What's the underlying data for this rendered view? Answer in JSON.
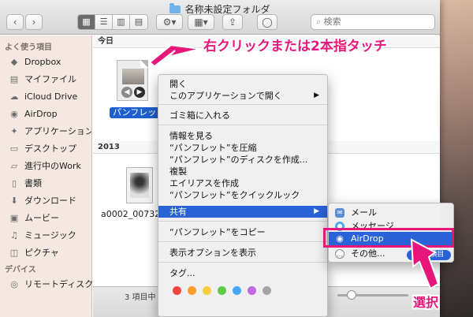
{
  "window": {
    "title": "名称未設定フォルダ",
    "search_placeholder": "検索"
  },
  "toolbar": {
    "back_icon": "chevron-left-icon",
    "forward_icon": "chevron-right-icon",
    "view_modes": [
      "icon-view",
      "list-view",
      "column-view",
      "coverflow-view"
    ],
    "active_view": "icon-view"
  },
  "sidebar": {
    "favorites_header": "よく使う項目",
    "items": [
      {
        "label": "Dropbox",
        "icon": "dropbox-icon"
      },
      {
        "label": "マイファイル",
        "icon": "all-files-icon"
      },
      {
        "label": "iCloud Drive",
        "icon": "cloud-icon"
      },
      {
        "label": "AirDrop",
        "icon": "airdrop-icon"
      },
      {
        "label": "アプリケーション",
        "icon": "applications-icon"
      },
      {
        "label": "デスクトップ",
        "icon": "desktop-icon"
      },
      {
        "label": "進行中のWork",
        "icon": "folder-icon"
      },
      {
        "label": "書類",
        "icon": "documents-icon"
      },
      {
        "label": "ダウンロード",
        "icon": "download-icon"
      },
      {
        "label": "ムービー",
        "icon": "movies-icon"
      },
      {
        "label": "ミュージック",
        "icon": "music-icon"
      },
      {
        "label": "ピクチャ",
        "icon": "pictures-icon"
      }
    ],
    "devices_header": "デバイス",
    "device_items": [
      {
        "label": "リモートディスク",
        "icon": "remote-disc-icon"
      }
    ]
  },
  "content": {
    "group_today": "今日",
    "group_2013": "2013",
    "file_selected": "パンフレット",
    "file_other": "a0002_007328.jpg",
    "status_text": "3 項目中"
  },
  "context_menu": {
    "items": [
      "開く",
      "このアプリケーションで開く",
      "ゴミ箱に入れる",
      "情報を見る",
      "“パンフレット”を圧縮",
      "“パンフレット”のディスクを作成...",
      "複製",
      "エイリアスを作成",
      "“パンフレット”をクイックルック",
      "共有",
      "“パンフレット”をコピー",
      "表示オプションを表示",
      "タグ..."
    ],
    "selected": "共有",
    "tag_colors": [
      "#f3453d",
      "#fb9d2b",
      "#f8d03b",
      "#5fcb49",
      "#46a8f6",
      "#c36ae0",
      "#a4a4a4"
    ]
  },
  "share_submenu": {
    "items": [
      {
        "label": "メール",
        "icon": "mail-icon"
      },
      {
        "label": "メッセージ",
        "icon": "messages-icon"
      },
      {
        "label": "AirDrop",
        "icon": "airdrop-icon"
      },
      {
        "label": "その他...",
        "icon": "more-icon"
      }
    ],
    "selected": "AirDrop",
    "badge": "規 1 項目"
  },
  "annotations": {
    "top": "右クリックまたは2本指タッチ",
    "bottom": "選択",
    "color": "#e8167a"
  }
}
